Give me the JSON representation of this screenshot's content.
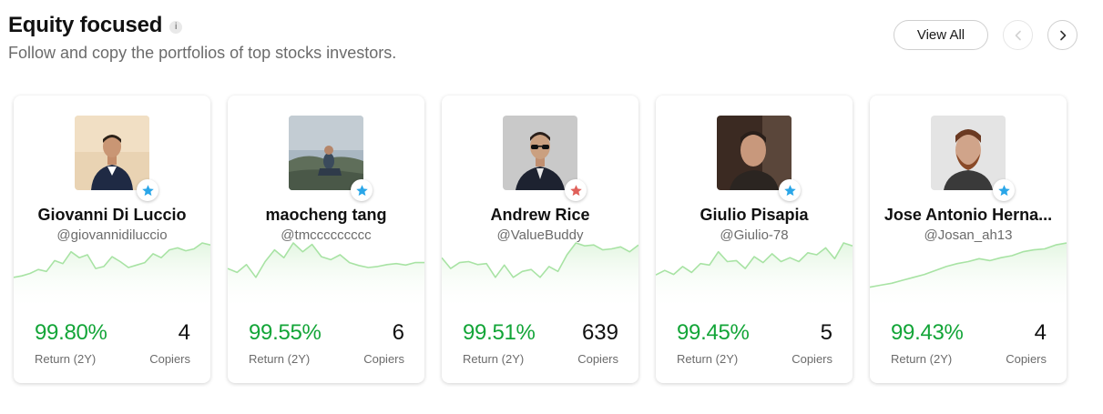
{
  "header": {
    "title": "Equity focused",
    "info_icon": "i",
    "subtitle": "Follow and copy the portfolios of top stocks investors."
  },
  "controls": {
    "view_all_label": "View All",
    "prev_icon": "chevron-left-icon",
    "next_icon": "chevron-right-icon"
  },
  "colors": {
    "return_green": "#13a538",
    "star_blue": "#2aa6e8",
    "star_red": "#e0605a",
    "sparkline": "#a8e3a4"
  },
  "cards": [
    {
      "name": "Giovanni Di Luccio",
      "handle": "@giovannidiluccio",
      "return_value": "99.80%",
      "return_label": "Return (2Y)",
      "copiers_value": "4",
      "copiers_label": "Copiers",
      "star_color": "blue",
      "sparkline": [
        0.3,
        0.33,
        0.38,
        0.46,
        0.42,
        0.64,
        0.58,
        0.82,
        0.7,
        0.76,
        0.48,
        0.52,
        0.72,
        0.62,
        0.5,
        0.55,
        0.6,
        0.78,
        0.7,
        0.86,
        0.9,
        0.84,
        0.88,
        1.0,
        0.96
      ]
    },
    {
      "name": "maocheng tang",
      "handle": "@tmccccccccc",
      "return_value": "99.55%",
      "return_label": "Return (2Y)",
      "copiers_value": "6",
      "copiers_label": "Copiers",
      "star_color": "blue",
      "sparkline": [
        0.48,
        0.4,
        0.56,
        0.3,
        0.62,
        0.86,
        0.7,
        1.0,
        0.82,
        0.97,
        0.72,
        0.66,
        0.76,
        0.6,
        0.54,
        0.5,
        0.52,
        0.56,
        0.58,
        0.55,
        0.6,
        0.6
      ]
    },
    {
      "name": "Andrew Rice",
      "handle": "@ValueBuddy",
      "return_value": "99.51%",
      "return_label": "Return (2Y)",
      "copiers_value": "639",
      "copiers_label": "Copiers",
      "star_color": "red",
      "sparkline": [
        0.7,
        0.48,
        0.6,
        0.62,
        0.56,
        0.58,
        0.3,
        0.55,
        0.3,
        0.42,
        0.46,
        0.3,
        0.52,
        0.42,
        0.76,
        1.0,
        0.94,
        0.96,
        0.86,
        0.88,
        0.92,
        0.82,
        0.96
      ]
    },
    {
      "name": "Giulio Pisapia",
      "handle": "@Giulio-78",
      "return_value": "99.45%",
      "return_label": "Return (2Y)",
      "copiers_value": "5",
      "copiers_label": "Copiers",
      "star_color": "blue",
      "sparkline": [
        0.35,
        0.44,
        0.36,
        0.52,
        0.4,
        0.58,
        0.55,
        0.82,
        0.62,
        0.64,
        0.48,
        0.72,
        0.6,
        0.78,
        0.62,
        0.7,
        0.62,
        0.8,
        0.76,
        0.9,
        0.68,
        1.0,
        0.94
      ]
    },
    {
      "name": "Jose Antonio Herna...",
      "handle": "@Josan_ah13",
      "return_value": "99.43%",
      "return_label": "Return (2Y)",
      "copiers_value": "4",
      "copiers_label": "Copiers",
      "star_color": "blue",
      "sparkline": [
        0.1,
        0.14,
        0.18,
        0.24,
        0.3,
        0.36,
        0.44,
        0.52,
        0.58,
        0.62,
        0.68,
        0.64,
        0.7,
        0.74,
        0.82,
        0.86,
        0.88,
        0.96,
        1.0
      ]
    }
  ]
}
